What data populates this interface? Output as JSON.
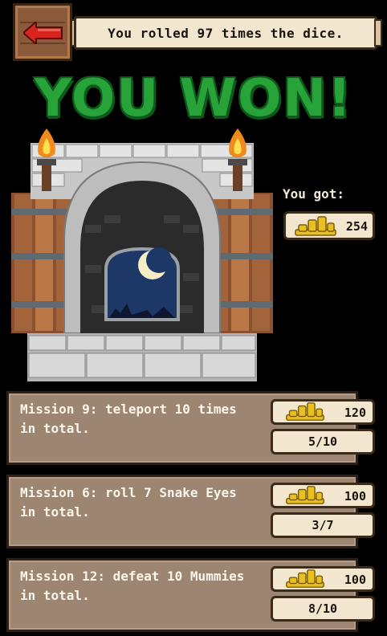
{
  "header": {
    "back_icon": "left-arrow-icon",
    "message": "You rolled 97 times the dice."
  },
  "result": {
    "title": "YOU WON!",
    "you_got_label": "You got:",
    "reward_amount": "254",
    "reward_icon": "gold-coins-icon"
  },
  "missions": [
    {
      "text": "Mission 9: teleport 10 times in total.",
      "reward": "120",
      "progress": "5/10"
    },
    {
      "text": "Mission 6: roll 7 Snake Eyes in total.",
      "reward": "100",
      "progress": "3/7"
    },
    {
      "text": "Mission 12: defeat 10 Mummies in total.",
      "reward": "100",
      "progress": "8/10"
    }
  ],
  "colors": {
    "title_green": "#27a33a",
    "panel_brown": "#9c8672",
    "pill_cream": "#f3e6cf",
    "coin_gold": "#e8c020"
  }
}
